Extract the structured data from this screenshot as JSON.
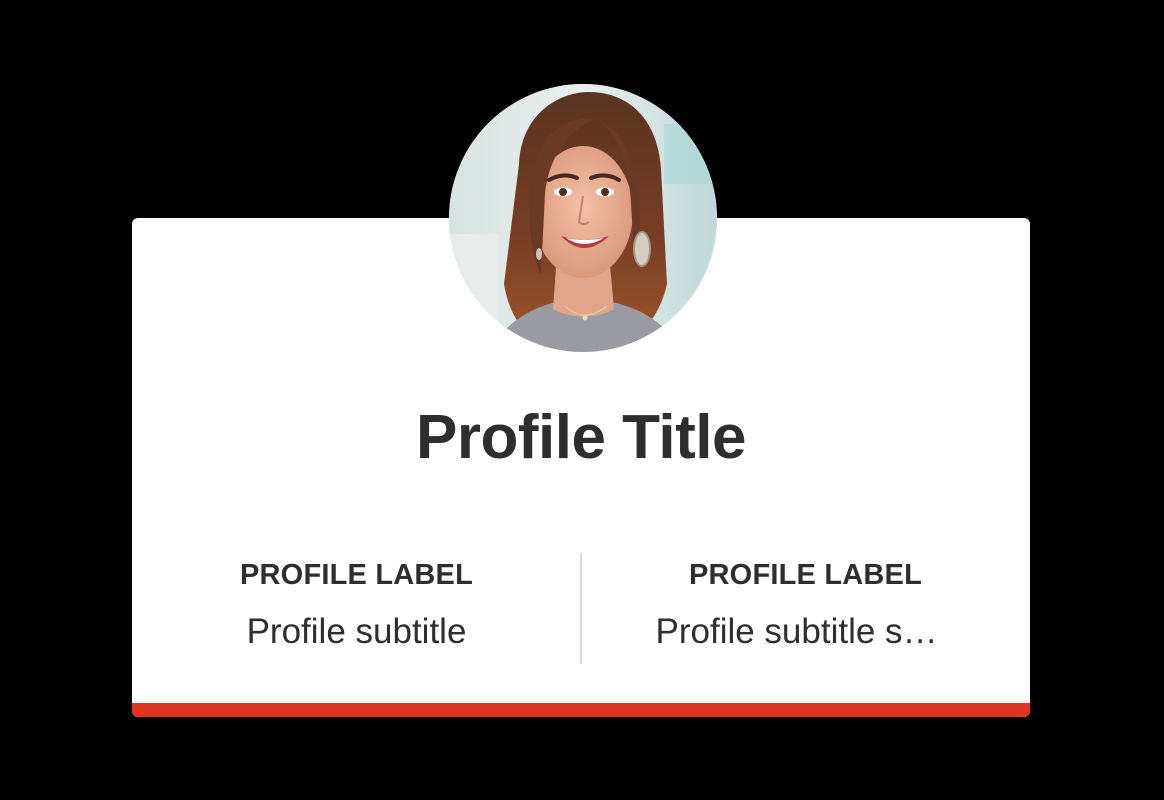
{
  "profile": {
    "title": "Profile Title",
    "stats": [
      {
        "label": "PROFILE LABEL",
        "subtitle": "Profile subtitle"
      },
      {
        "label": "PROFILE LABEL",
        "subtitle": "Profile subtitle subtitle"
      }
    ],
    "avatar_icon": "profile-photo",
    "colors": {
      "background": "#000000",
      "card": "#ffffff",
      "accent": "#e03424",
      "text": "#2e2e2e",
      "divider": "#d9d9d9"
    }
  }
}
